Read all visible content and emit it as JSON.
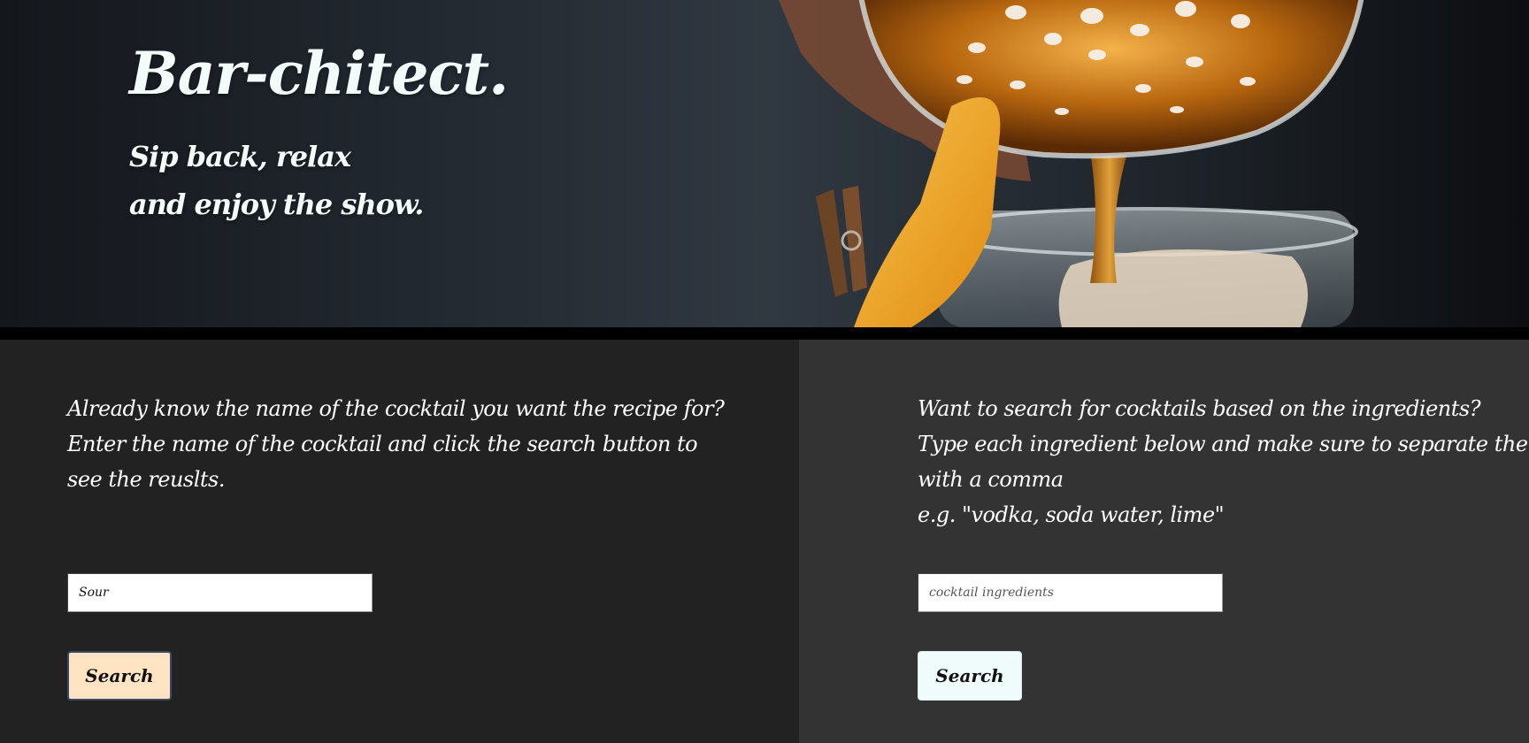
{
  "hero": {
    "title": "Bar-chitect.",
    "tagline": [
      "Sip back, relax",
      "and enjoy the show."
    ]
  },
  "name_search": {
    "description": [
      "Already know the name of the cocktail you want the recipe for?",
      "Enter the name of the cocktail and click the search button to",
      "see the reuslts."
    ],
    "input_value": "Sour",
    "button_label": "Search",
    "button_color": "#ffe4c4"
  },
  "ingredient_search": {
    "description": [
      "Want to search for cocktails based on the ingredients?",
      "Type each ingredient below and make sure to separate them",
      "with a comma",
      "e.g. \"vodka, soda water, lime\""
    ],
    "input_value": "",
    "input_placeholder": "cocktail ingredients",
    "button_label": "Search",
    "button_color": "#f0fbfb"
  }
}
